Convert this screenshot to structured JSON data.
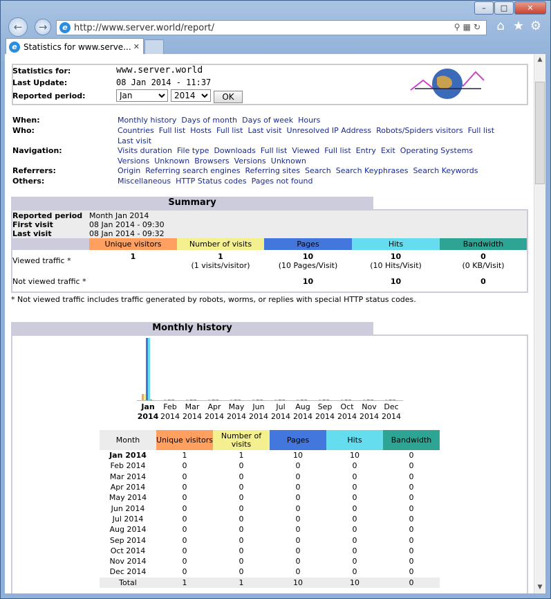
{
  "browser": {
    "url": "http://www.server.world/report/",
    "tab_title": "Statistics for www.serve...",
    "window_buttons": [
      "–",
      "□",
      "✕"
    ]
  },
  "header": {
    "stats_for_label": "Statistics for:",
    "stats_for_value": "www.server.world",
    "last_update_label": "Last Update:",
    "last_update_value": "08 Jan 2014 - 11:37",
    "period_label": "Reported period:",
    "month": "Jan",
    "year": "2014",
    "ok": "OK"
  },
  "nav": {
    "when": {
      "label": "When:",
      "links": [
        "Monthly history",
        "Days of month",
        "Days of week",
        "Hours"
      ]
    },
    "who": {
      "label": "Who:",
      "links": [
        "Countries",
        "Full list",
        "Hosts",
        "Full list",
        "Last visit",
        "Unresolved IP Address",
        "Robots/Spiders visitors",
        "Full list",
        "Last visit"
      ]
    },
    "navigation": {
      "label": "Navigation:",
      "links": [
        "Visits duration",
        "File type",
        "Downloads",
        "Full list",
        "Viewed",
        "Full list",
        "Entry",
        "Exit",
        "Operating Systems",
        "Versions",
        "Unknown",
        "Browsers",
        "Versions",
        "Unknown"
      ]
    },
    "referrers": {
      "label": "Referrers:",
      "links": [
        "Origin",
        "Referring search engines",
        "Referring sites",
        "Search",
        "Search Keyphrases",
        "Search Keywords"
      ]
    },
    "others": {
      "label": "Others:",
      "links": [
        "Miscellaneous",
        "HTTP Status codes",
        "Pages not found"
      ]
    }
  },
  "summary": {
    "title": "Summary",
    "reported_period_label": "Reported period",
    "reported_period_value": "Month Jan 2014",
    "first_visit_label": "First visit",
    "first_visit_value": "08 Jan 2014 - 09:30",
    "last_visit_label": "Last visit",
    "last_visit_value": "08 Jan 2014 - 09:32",
    "cols": [
      "Unique visitors",
      "Number of visits",
      "Pages",
      "Hits",
      "Bandwidth"
    ],
    "viewed_label": "Viewed traffic *",
    "viewed": [
      "1",
      "1",
      "10",
      "10",
      "0"
    ],
    "viewed_sub": [
      "",
      "(1 visits/visitor)",
      "(10 Pages/Visit)",
      "(10 Hits/Visit)",
      "(0 KB/Visit)"
    ],
    "notviewed_label": "Not viewed traffic *",
    "notviewed": [
      "",
      "",
      "10",
      "10",
      "0"
    ],
    "footnote": "* Not viewed traffic includes traffic generated by robots, worms, or replies with special HTTP status codes."
  },
  "monthly": {
    "title": "Monthly history",
    "months": [
      "Jan",
      "Feb",
      "Mar",
      "Apr",
      "May",
      "Jun",
      "Jul",
      "Aug",
      "Sep",
      "Oct",
      "Nov",
      "Dec"
    ],
    "year": "2014",
    "cols": [
      "Month",
      "Unique visitors",
      "Number of visits",
      "Pages",
      "Hits",
      "Bandwidth"
    ],
    "rows": [
      [
        "Jan 2014",
        "1",
        "1",
        "10",
        "10",
        "0"
      ],
      [
        "Feb 2014",
        "0",
        "0",
        "0",
        "0",
        "0"
      ],
      [
        "Mar 2014",
        "0",
        "0",
        "0",
        "0",
        "0"
      ],
      [
        "Apr 2014",
        "0",
        "0",
        "0",
        "0",
        "0"
      ],
      [
        "May 2014",
        "0",
        "0",
        "0",
        "0",
        "0"
      ],
      [
        "Jun 2014",
        "0",
        "0",
        "0",
        "0",
        "0"
      ],
      [
        "Jul 2014",
        "0",
        "0",
        "0",
        "0",
        "0"
      ],
      [
        "Aug 2014",
        "0",
        "0",
        "0",
        "0",
        "0"
      ],
      [
        "Sep 2014",
        "0",
        "0",
        "0",
        "0",
        "0"
      ],
      [
        "Oct 2014",
        "0",
        "0",
        "0",
        "0",
        "0"
      ],
      [
        "Nov 2014",
        "0",
        "0",
        "0",
        "0",
        "0"
      ],
      [
        "Dec 2014",
        "0",
        "0",
        "0",
        "0",
        "0"
      ]
    ],
    "total": [
      "Total",
      "1",
      "1",
      "10",
      "10",
      "0"
    ]
  },
  "colors": {
    "visitors": "#ffa060",
    "visits": "#f4f090",
    "pages": "#4477dd",
    "hits": "#66ddee",
    "bandwidth": "#2ea495"
  }
}
